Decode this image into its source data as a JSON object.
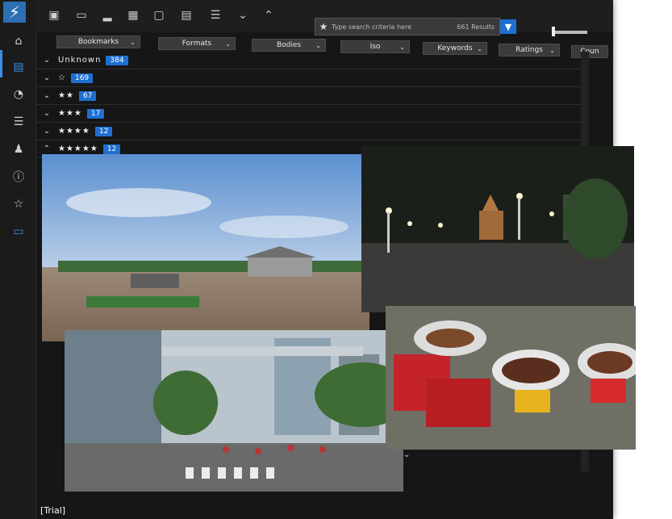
{
  "sidebar": {
    "logo": "⚡",
    "items": [
      {
        "name": "home-icon",
        "glyph": "⌂"
      },
      {
        "name": "browser-icon",
        "glyph": "▤"
      },
      {
        "name": "chart-icon",
        "glyph": "◔"
      },
      {
        "name": "adjust-icon",
        "glyph": "☰"
      },
      {
        "name": "people-icon",
        "glyph": "♟"
      },
      {
        "name": "info-icon",
        "glyph": "ⓘ"
      },
      {
        "name": "lightbulb-icon",
        "glyph": "☆"
      },
      {
        "name": "card-icon",
        "glyph": "▭"
      }
    ],
    "trial_label": "[Trial]"
  },
  "toolbar": {
    "search_placeholder": "Type search criteria here",
    "results": "661 Results",
    "search_icon": "★",
    "filter_icon": "▼"
  },
  "filters": [
    "Bookmarks",
    "Formats",
    "Bodies",
    "Iso",
    "Keywords",
    "Ratings",
    "Coun"
  ],
  "groups": [
    {
      "label": "Unknown",
      "count": "384",
      "expanded": false
    },
    {
      "label": "☆",
      "count": "169",
      "expanded": false
    },
    {
      "label": "★★",
      "count": "67",
      "expanded": false
    },
    {
      "label": "★★★",
      "count": "17",
      "expanded": false
    },
    {
      "label": "★★★★",
      "count": "12",
      "expanded": false
    },
    {
      "label": "★★★★★",
      "count": "12",
      "expanded": true
    }
  ],
  "colors": {
    "accent": "#1f6fd1",
    "background": "#141414"
  }
}
